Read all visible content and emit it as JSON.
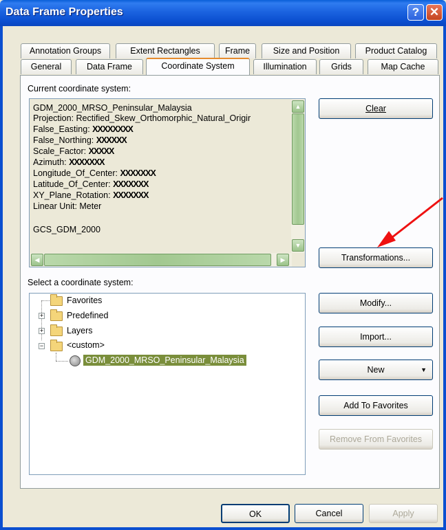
{
  "window": {
    "title": "Data Frame Properties",
    "help": "?",
    "close": "✕"
  },
  "tabs_row1": [
    "Annotation Groups",
    "Extent Rectangles",
    "Frame",
    "Size and Position",
    "Product Catalog"
  ],
  "tabs_row2": [
    "General",
    "Data Frame",
    "Coordinate System",
    "Illumination",
    "Grids",
    "Map Cache"
  ],
  "active_tab": "Coordinate System",
  "current_cs": {
    "label": "Current coordinate system:",
    "name": "GDM_2000_MRSO_Peninsular_Malaysia",
    "projection": "Projection: Rectified_Skew_Orthomorphic_Natural_Origir",
    "params": [
      {
        "key": "False_Easting:",
        "value": "XXXXXXXX"
      },
      {
        "key": "False_Northing:",
        "value": "XXXXXX"
      },
      {
        "key": "Scale_Factor:",
        "value": "XXXXX"
      },
      {
        "key": "Azimuth:",
        "value": "XXXXXXX"
      },
      {
        "key": "Longitude_Of_Center:",
        "value": "XXXXXXX"
      },
      {
        "key": "Latitude_Of_Center:",
        "value": "XXXXXXX"
      },
      {
        "key": "XY_Plane_Rotation:",
        "value": "XXXXXXX"
      }
    ],
    "linear_unit": "Linear Unit: Meter",
    "gcs": "GCS_GDM_2000"
  },
  "select_cs": {
    "label": "Select a coordinate system:",
    "tree": {
      "favorites": "Favorites",
      "predefined": "Predefined",
      "layers": "Layers",
      "custom": "<custom>",
      "selected_item": "GDM_2000_MRSO_Peninsular_Malaysia"
    }
  },
  "buttons": {
    "clear": "Clear",
    "transformations": "Transformations...",
    "modify": "Modify...",
    "import": "Import...",
    "new": "New",
    "add_to_favorites": "Add To Favorites",
    "remove_from_favorites": "Remove From Favorites",
    "ok": "OK",
    "cancel": "Cancel",
    "apply": "Apply"
  },
  "colors": {
    "annotation_arrow": "#ee1111",
    "title_bar": "#0b4fd0",
    "selection": "#7a8e3b"
  }
}
